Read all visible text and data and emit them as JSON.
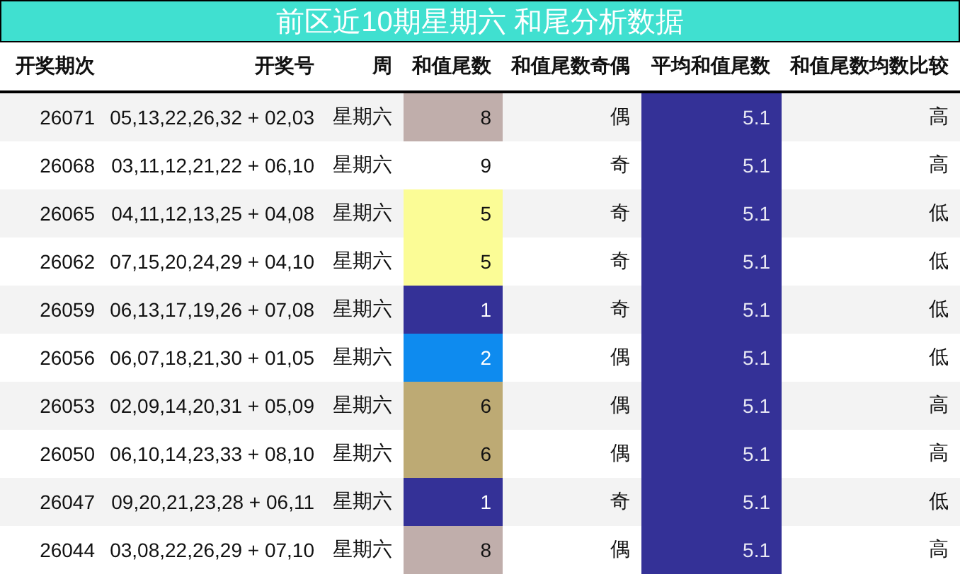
{
  "title": "前区近10期星期六 和尾分析数据",
  "columns": [
    "开奖期次",
    "开奖号",
    "周",
    "和值尾数",
    "和值尾数奇偶",
    "平均和值尾数",
    "和值尾数均数比较"
  ],
  "rows": [
    {
      "issue": "26071",
      "numbers": "05,13,22,26,32 + 02,03",
      "weekday": "星期六",
      "tail": "8",
      "color": "#c0aeab",
      "parity": "偶",
      "average": "5.1",
      "compare": "高"
    },
    {
      "issue": "26068",
      "numbers": "03,11,12,21,22 + 06,10",
      "weekday": "星期六",
      "tail": "9",
      "color": "#ffffff",
      "parity": "奇",
      "average": "5.1",
      "compare": "高"
    },
    {
      "issue": "26065",
      "numbers": "04,11,12,13,25 + 04,08",
      "weekday": "星期六",
      "tail": "5",
      "color": "#fbfc96",
      "parity": "奇",
      "average": "5.1",
      "compare": "低"
    },
    {
      "issue": "26062",
      "numbers": "07,15,20,24,29 + 04,10",
      "weekday": "星期六",
      "tail": "5",
      "color": "#fbfc96",
      "parity": "奇",
      "average": "5.1",
      "compare": "低"
    },
    {
      "issue": "26059",
      "numbers": "06,13,17,19,26 + 07,08",
      "weekday": "星期六",
      "tail": "1",
      "color": "#343197",
      "parity": "奇",
      "average": "5.1",
      "compare": "低"
    },
    {
      "issue": "26056",
      "numbers": "06,07,18,21,30 + 01,05",
      "weekday": "星期六",
      "tail": "2",
      "color": "#0e8bef",
      "parity": "偶",
      "average": "5.1",
      "compare": "低"
    },
    {
      "issue": "26053",
      "numbers": "02,09,14,20,31 + 05,09",
      "weekday": "星期六",
      "tail": "6",
      "color": "#bdaa74",
      "parity": "偶",
      "average": "5.1",
      "compare": "高"
    },
    {
      "issue": "26050",
      "numbers": "06,10,14,23,33 + 08,10",
      "weekday": "星期六",
      "tail": "6",
      "color": "#bdaa74",
      "parity": "偶",
      "average": "5.1",
      "compare": "高"
    },
    {
      "issue": "26047",
      "numbers": "09,20,21,23,28 + 06,11",
      "weekday": "星期六",
      "tail": "1",
      "color": "#343197",
      "parity": "奇",
      "average": "5.1",
      "compare": "低"
    },
    {
      "issue": "26044",
      "numbers": "03,08,22,26,29 + 07,10",
      "weekday": "星期六",
      "tail": "8",
      "color": "#c0aeab",
      "parity": "偶",
      "average": "5.1",
      "compare": "高"
    }
  ]
}
